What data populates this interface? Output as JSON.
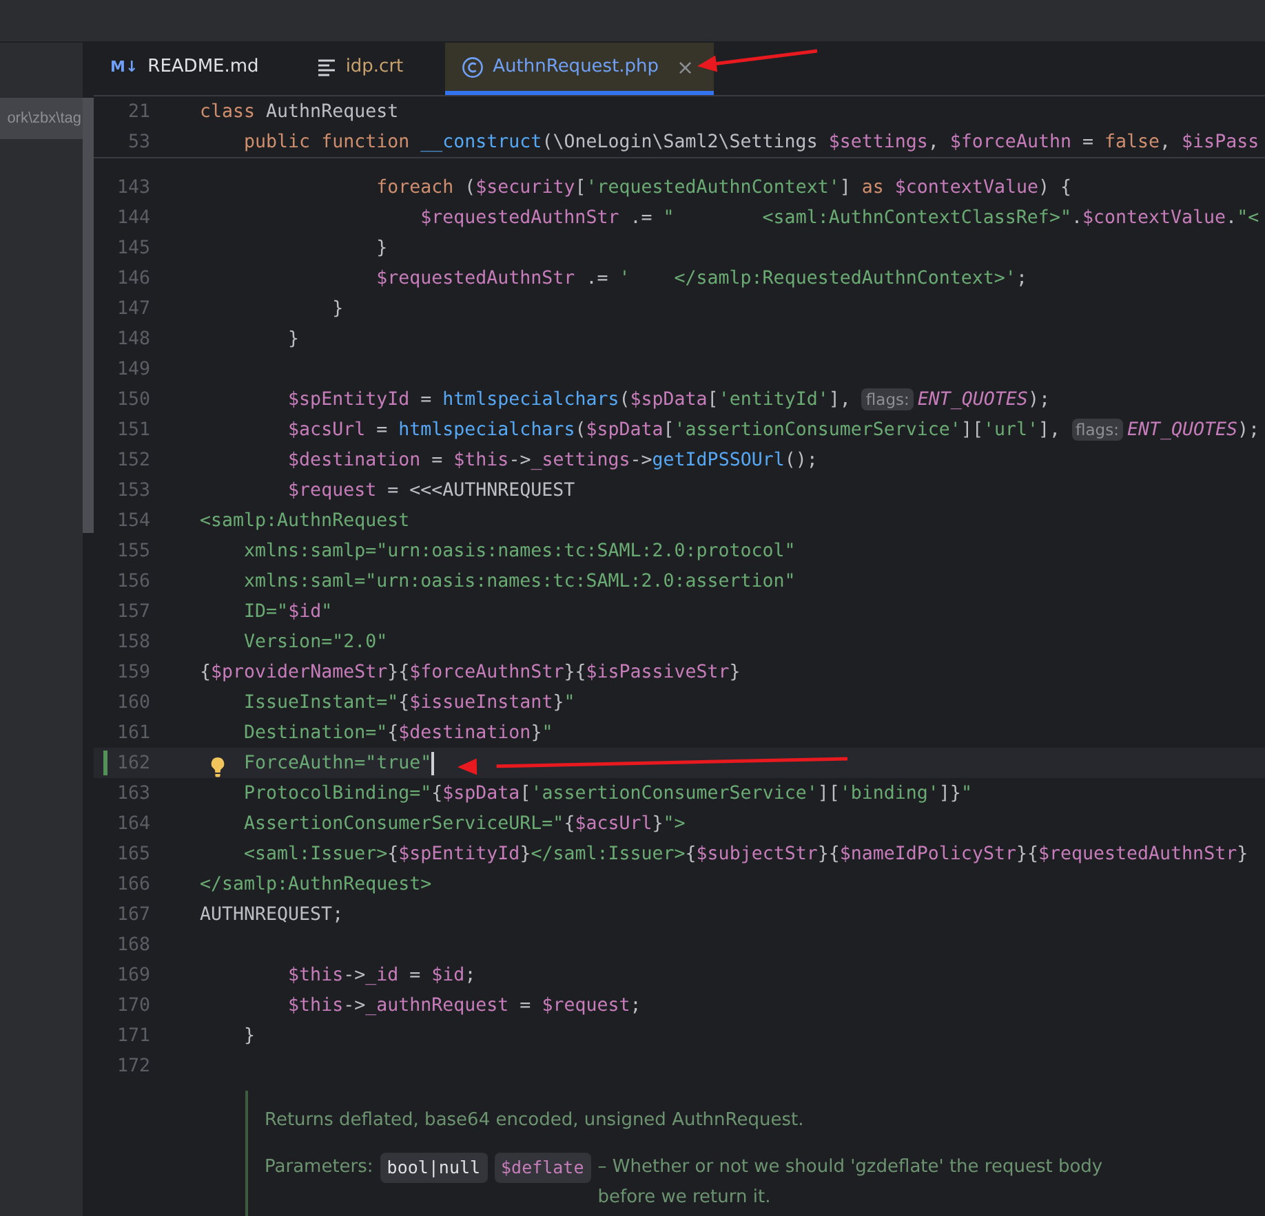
{
  "project_panel": {
    "path_fragment": "ork\\zbx\\tag"
  },
  "tabs": [
    {
      "label": "README.md",
      "kind": "markdown",
      "icon_text": "M↓",
      "color": "#dfe1e5",
      "selected": false,
      "closable": false
    },
    {
      "label": "idp.crt",
      "kind": "text",
      "color": "#c9a26d",
      "selected": false,
      "closable": false
    },
    {
      "label": "AuthnRequest.php",
      "kind": "class",
      "color": "#6fa0f5",
      "selected": true,
      "closable": true,
      "close_glyph": "×"
    }
  ],
  "sticky_lines": [
    {
      "number": "21",
      "tokens": [
        {
          "kind": "kw",
          "text": "class"
        },
        {
          "kind": "p",
          "text": " AuthnRequest"
        }
      ]
    },
    {
      "number": "53",
      "tokens": [
        {
          "kind": "kw",
          "text": "    public function "
        },
        {
          "kind": "fn",
          "text": "__construct"
        },
        {
          "kind": "p",
          "text": "(\\OneLogin\\Saml2\\Settings "
        },
        {
          "kind": "var",
          "text": "$settings"
        },
        {
          "kind": "p",
          "text": ", "
        },
        {
          "kind": "var",
          "text": "$forceAuthn"
        },
        {
          "kind": "p",
          "text": " = "
        },
        {
          "kind": "kw",
          "text": "false"
        },
        {
          "kind": "p",
          "text": ", "
        },
        {
          "kind": "var",
          "text": "$isPass"
        }
      ]
    }
  ],
  "lines": [
    {
      "number": "143",
      "current": false,
      "tokens": [
        {
          "kind": "kw",
          "text": "                foreach"
        },
        {
          "kind": "p",
          "text": " ("
        },
        {
          "kind": "var",
          "text": "$security"
        },
        {
          "kind": "p",
          "text": "["
        },
        {
          "kind": "str",
          "text": "'requestedAuthnContext'"
        },
        {
          "kind": "p",
          "text": "] "
        },
        {
          "kind": "kw",
          "text": "as"
        },
        {
          "kind": "var",
          "text": " $contextValue"
        },
        {
          "kind": "p",
          "text": ") {"
        }
      ]
    },
    {
      "number": "144",
      "current": false,
      "tokens": [
        {
          "kind": "var",
          "text": "                    $requestedAuthnStr"
        },
        {
          "kind": "p",
          "text": " .= "
        },
        {
          "kind": "str",
          "text": "\"        <saml:AuthnContextClassRef>\""
        },
        {
          "kind": "p",
          "text": "."
        },
        {
          "kind": "var",
          "text": "$contextValue"
        },
        {
          "kind": "p",
          "text": "."
        },
        {
          "kind": "str",
          "text": "\"<"
        }
      ]
    },
    {
      "number": "145",
      "current": false,
      "tokens": [
        {
          "kind": "p",
          "text": "                }"
        }
      ]
    },
    {
      "number": "146",
      "current": false,
      "tokens": [
        {
          "kind": "var",
          "text": "                $requestedAuthnStr"
        },
        {
          "kind": "p",
          "text": " .= "
        },
        {
          "kind": "str",
          "text": "'    </samlp:RequestedAuthnContext>'"
        },
        {
          "kind": "p",
          "text": ";"
        }
      ]
    },
    {
      "number": "147",
      "current": false,
      "tokens": [
        {
          "kind": "p",
          "text": "            }"
        }
      ]
    },
    {
      "number": "148",
      "current": false,
      "tokens": [
        {
          "kind": "p",
          "text": "        }"
        }
      ]
    },
    {
      "number": "149",
      "current": false
    },
    {
      "number": "150",
      "current": false,
      "tokens": [
        {
          "kind": "var",
          "text": "        $spEntityId"
        },
        {
          "kind": "p",
          "text": " = "
        },
        {
          "kind": "fn",
          "text": "htmlspecialchars"
        },
        {
          "kind": "p",
          "text": "("
        },
        {
          "kind": "var",
          "text": "$spData"
        },
        {
          "kind": "p",
          "text": "["
        },
        {
          "kind": "str",
          "text": "'entityId'"
        },
        {
          "kind": "p",
          "text": "], "
        },
        {
          "kind": "hint",
          "text": "flags:"
        },
        {
          "kind": "const",
          "text": "ENT_QUOTES"
        },
        {
          "kind": "p",
          "text": ");"
        }
      ]
    },
    {
      "number": "151",
      "current": false,
      "tokens": [
        {
          "kind": "var",
          "text": "        $acsUrl"
        },
        {
          "kind": "p",
          "text": " = "
        },
        {
          "kind": "fn",
          "text": "htmlspecialchars"
        },
        {
          "kind": "p",
          "text": "("
        },
        {
          "kind": "var",
          "text": "$spData"
        },
        {
          "kind": "p",
          "text": "["
        },
        {
          "kind": "str",
          "text": "'assertionConsumerService'"
        },
        {
          "kind": "p",
          "text": "]["
        },
        {
          "kind": "str",
          "text": "'url'"
        },
        {
          "kind": "p",
          "text": "], "
        },
        {
          "kind": "hint",
          "text": "flags:"
        },
        {
          "kind": "const",
          "text": "ENT_QUOTES"
        },
        {
          "kind": "p",
          "text": ");"
        }
      ]
    },
    {
      "number": "152",
      "current": false,
      "tokens": [
        {
          "kind": "var",
          "text": "        $destination"
        },
        {
          "kind": "p",
          "text": " = "
        },
        {
          "kind": "var",
          "text": "$this"
        },
        {
          "kind": "p",
          "text": "->"
        },
        {
          "kind": "var",
          "text": "_settings"
        },
        {
          "kind": "p",
          "text": "->"
        },
        {
          "kind": "fn",
          "text": "getIdPSSOUrl"
        },
        {
          "kind": "p",
          "text": "();"
        }
      ]
    },
    {
      "number": "153",
      "current": false,
      "tokens": [
        {
          "kind": "var",
          "text": "        $request"
        },
        {
          "kind": "p",
          "text": " = <<<AUTHNREQUEST"
        }
      ]
    },
    {
      "number": "154",
      "current": false,
      "tokens": [
        {
          "kind": "str",
          "text": "<samlp:AuthnRequest"
        }
      ]
    },
    {
      "number": "155",
      "current": false,
      "tokens": [
        {
          "kind": "str",
          "text": "    xmlns:samlp=\"urn:oasis:names:tc:SAML:2.0:protocol\""
        }
      ]
    },
    {
      "number": "156",
      "current": false,
      "tokens": [
        {
          "kind": "str",
          "text": "    xmlns:saml=\"urn:oasis:names:tc:SAML:2.0:assertion\""
        }
      ]
    },
    {
      "number": "157",
      "current": false,
      "tokens": [
        {
          "kind": "str",
          "text": "    ID=\""
        },
        {
          "kind": "var",
          "text": "$id"
        },
        {
          "kind": "str",
          "text": "\""
        }
      ]
    },
    {
      "number": "158",
      "current": false,
      "tokens": [
        {
          "kind": "str",
          "text": "    Version=\"2.0\""
        }
      ]
    },
    {
      "number": "159",
      "current": false,
      "tokens": [
        {
          "kind": "p",
          "text": "{"
        },
        {
          "kind": "var",
          "text": "$providerNameStr"
        },
        {
          "kind": "p",
          "text": "}{"
        },
        {
          "kind": "var",
          "text": "$forceAuthnStr"
        },
        {
          "kind": "p",
          "text": "}{"
        },
        {
          "kind": "var",
          "text": "$isPassiveStr"
        },
        {
          "kind": "p",
          "text": "}"
        }
      ]
    },
    {
      "number": "160",
      "current": false,
      "tokens": [
        {
          "kind": "str",
          "text": "    IssueInstant=\""
        },
        {
          "kind": "p",
          "text": "{"
        },
        {
          "kind": "var",
          "text": "$issueInstant"
        },
        {
          "kind": "p",
          "text": "}"
        },
        {
          "kind": "str",
          "text": "\""
        }
      ]
    },
    {
      "number": "161",
      "current": false,
      "tokens": [
        {
          "kind": "str",
          "text": "    Destination=\""
        },
        {
          "kind": "p",
          "text": "{"
        },
        {
          "kind": "var",
          "text": "$destination"
        },
        {
          "kind": "p",
          "text": "}"
        },
        {
          "kind": "str",
          "text": "\""
        }
      ]
    },
    {
      "number": "162",
      "current": true,
      "modified": true,
      "intention_bulb": true,
      "tokens": [
        {
          "kind": "str",
          "text": "    ForceAuthn=\"true\""
        }
      ]
    },
    {
      "number": "163",
      "current": false,
      "tokens": [
        {
          "kind": "str",
          "text": "    ProtocolBinding=\""
        },
        {
          "kind": "p",
          "text": "{"
        },
        {
          "kind": "var",
          "text": "$spData"
        },
        {
          "kind": "p",
          "text": "["
        },
        {
          "kind": "str",
          "text": "'assertionConsumerService'"
        },
        {
          "kind": "p",
          "text": "]["
        },
        {
          "kind": "str",
          "text": "'binding'"
        },
        {
          "kind": "p",
          "text": "]}"
        },
        {
          "kind": "str",
          "text": "\""
        }
      ]
    },
    {
      "number": "164",
      "current": false,
      "tokens": [
        {
          "kind": "str",
          "text": "    AssertionConsumerServiceURL=\""
        },
        {
          "kind": "p",
          "text": "{"
        },
        {
          "kind": "var",
          "text": "$acsUrl"
        },
        {
          "kind": "p",
          "text": "}"
        },
        {
          "kind": "str",
          "text": "\">"
        }
      ]
    },
    {
      "number": "165",
      "current": false,
      "tokens": [
        {
          "kind": "str",
          "text": "    <saml:Issuer>"
        },
        {
          "kind": "p",
          "text": "{"
        },
        {
          "kind": "var",
          "text": "$spEntityId"
        },
        {
          "kind": "p",
          "text": "}"
        },
        {
          "kind": "str",
          "text": "</saml:Issuer>"
        },
        {
          "kind": "p",
          "text": "{"
        },
        {
          "kind": "var",
          "text": "$subjectStr"
        },
        {
          "kind": "p",
          "text": "}{"
        },
        {
          "kind": "var",
          "text": "$nameIdPolicyStr"
        },
        {
          "kind": "p",
          "text": "}{"
        },
        {
          "kind": "var",
          "text": "$requestedAuthnStr"
        },
        {
          "kind": "p",
          "text": "}"
        }
      ]
    },
    {
      "number": "166",
      "current": false,
      "tokens": [
        {
          "kind": "str",
          "text": "</samlp:AuthnRequest>"
        }
      ]
    },
    {
      "number": "167",
      "current": false,
      "tokens": [
        {
          "kind": "p",
          "text": "AUTHNREQUEST;"
        }
      ]
    },
    {
      "number": "168",
      "current": false
    },
    {
      "number": "169",
      "current": false,
      "tokens": [
        {
          "kind": "var",
          "text": "        $this"
        },
        {
          "kind": "p",
          "text": "->"
        },
        {
          "kind": "var",
          "text": "_id"
        },
        {
          "kind": "p",
          "text": " = "
        },
        {
          "kind": "var",
          "text": "$id"
        },
        {
          "kind": "p",
          "text": ";"
        }
      ]
    },
    {
      "number": "170",
      "current": false,
      "tokens": [
        {
          "kind": "var",
          "text": "        $this"
        },
        {
          "kind": "p",
          "text": "->"
        },
        {
          "kind": "var",
          "text": "_authnRequest"
        },
        {
          "kind": "p",
          "text": " = "
        },
        {
          "kind": "var",
          "text": "$request"
        },
        {
          "kind": "p",
          "text": ";"
        }
      ]
    },
    {
      "number": "171",
      "current": false,
      "tokens": [
        {
          "kind": "p",
          "text": "    }"
        }
      ]
    },
    {
      "number": "172",
      "current": false
    }
  ],
  "doc": {
    "summary": "Returns deflated, base64 encoded, unsigned AuthnRequest.",
    "params_label": "Parameters:",
    "param_type": "bool|null",
    "param_name": "$deflate",
    "param_desc": "– Whether or not we should 'gzdeflate' the request body before we return it."
  },
  "annotations": [
    {
      "kind": "arrow"
    },
    {
      "kind": "arrow"
    }
  ]
}
